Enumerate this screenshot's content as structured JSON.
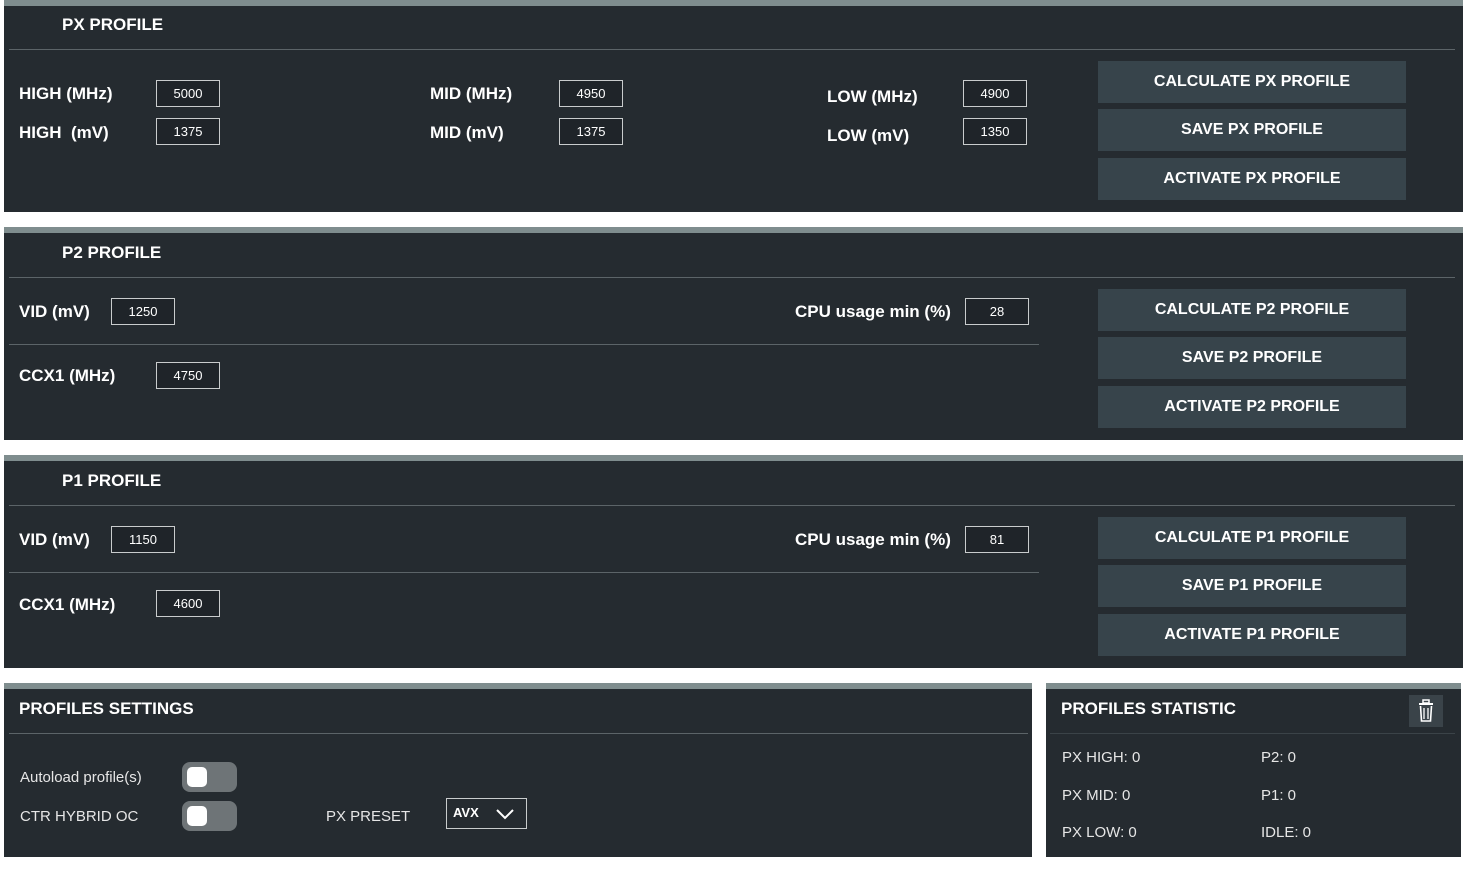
{
  "px_profile": {
    "title": "PX PROFILE",
    "high_mhz_label": "HIGH (MHz)",
    "high_mhz_value": "5000",
    "high_mv_label": "HIGH  (mV)",
    "high_mv_value": "1375",
    "mid_mhz_label": "MID (MHz)",
    "mid_mhz_value": "4950",
    "mid_mv_label": "MID (mV)",
    "mid_mv_value": "1375",
    "low_mhz_label": "LOW (MHz)",
    "low_mhz_value": "4900",
    "low_mv_label": "LOW (mV)",
    "low_mv_value": "1350",
    "calculate_label": "CALCULATE PX PROFILE",
    "save_label": "SAVE PX PROFILE",
    "activate_label": "ACTIVATE PX PROFILE"
  },
  "p2_profile": {
    "title": "P2 PROFILE",
    "vid_label": "VID (mV)",
    "vid_value": "1250",
    "cpu_usage_label": "CPU usage min (%)",
    "cpu_usage_value": "28",
    "ccx1_label": "CCX1 (MHz)",
    "ccx1_value": "4750",
    "calculate_label": "CALCULATE P2 PROFILE",
    "save_label": "SAVE P2 PROFILE",
    "activate_label": "ACTIVATE P2 PROFILE"
  },
  "p1_profile": {
    "title": "P1 PROFILE",
    "vid_label": "VID (mV)",
    "vid_value": "1150",
    "cpu_usage_label": "CPU usage min (%)",
    "cpu_usage_value": "81",
    "ccx1_label": "CCX1 (MHz)",
    "ccx1_value": "4600",
    "calculate_label": "CALCULATE P1 PROFILE",
    "save_label": "SAVE P1 PROFILE",
    "activate_label": "ACTIVATE P1 PROFILE"
  },
  "profiles_settings": {
    "title": "PROFILES SETTINGS",
    "autoload_label": "Autoload profile(s)",
    "autoload_on": false,
    "ctr_hybrid_label": "CTR HYBRID OC",
    "ctr_hybrid_on": false,
    "px_preset_label": "PX PRESET",
    "px_preset_value": "AVX"
  },
  "profiles_statistic": {
    "title": "PROFILES STATISTIC",
    "px_high": "PX HIGH: 0",
    "px_mid": "PX MID: 0",
    "px_low": "PX LOW: 0",
    "p2": "P2: 0",
    "p1": "P1: 0",
    "idle": "IDLE: 0",
    "clear_icon": "trash-icon"
  },
  "colors": {
    "panel_bg": "#252b30",
    "panel_top_border": "#7f8d8e",
    "button_bg": "#37444b",
    "toggle_off": "#6e7477"
  }
}
